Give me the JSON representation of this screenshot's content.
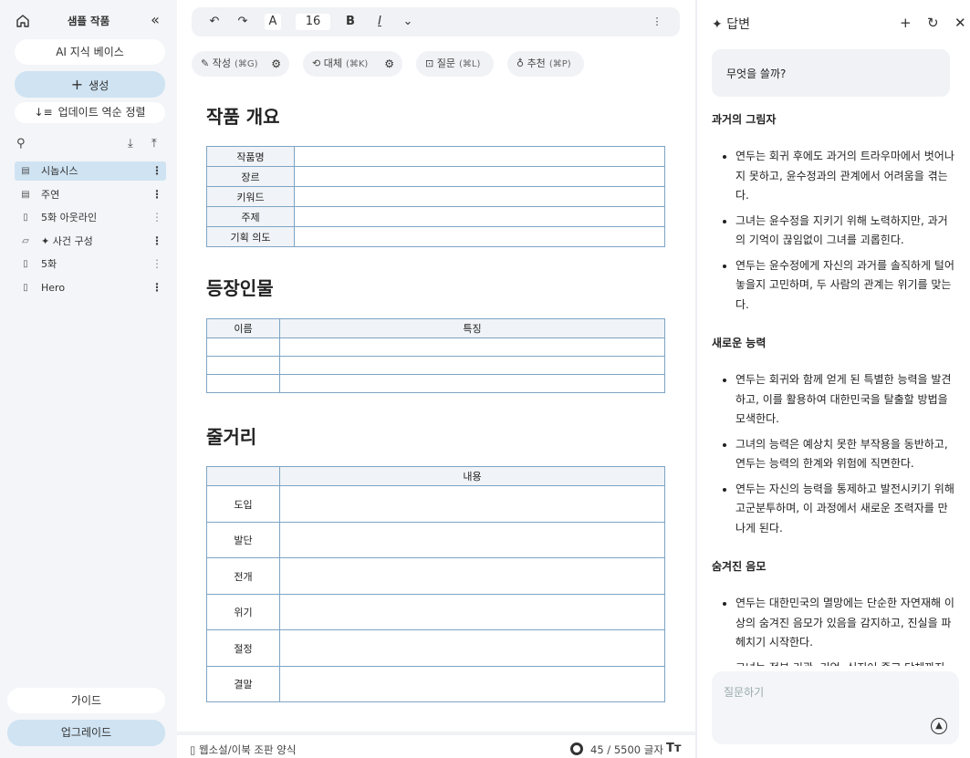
{
  "sidebar": {
    "title": "샘플 작품",
    "knowledge_base": "AI 지식 베이스",
    "create": "생성",
    "sort": "업데이트 역순 정렬",
    "items": [
      {
        "icon": "table-doc-icon",
        "label": "시놉시스",
        "active": true
      },
      {
        "icon": "table-doc-icon",
        "label": "주연",
        "active": false
      },
      {
        "icon": "document-icon",
        "label": "5화 아웃라인",
        "active": false
      },
      {
        "icon": "note-icon",
        "label": "✦ 사건 구성",
        "active": false
      },
      {
        "icon": "document-icon",
        "label": "5화",
        "active": false
      },
      {
        "icon": "document-icon",
        "label": "Hero",
        "active": false
      }
    ],
    "guide": "가이드",
    "upgrade": "업그레이드"
  },
  "toolbar": {
    "undo": "↶",
    "redo": "↷",
    "font": "A",
    "font_size": "16",
    "bold": "B",
    "italic": "I",
    "dropdown": "⌄",
    "more": "⋮"
  },
  "actions": [
    {
      "label": "작성",
      "key": "(⌘G)"
    },
    {
      "label": "대체",
      "key": "(⌘K)"
    },
    {
      "label": "질문",
      "key": "(⌘L)"
    },
    {
      "label": "추천",
      "key": "(⌘P)"
    }
  ],
  "document": {
    "overview_heading": "작품 개요",
    "overview_rows": [
      "작품명",
      "장르",
      "키워드",
      "주제",
      "기획 의도"
    ],
    "characters_heading": "등장인물",
    "characters_cols": [
      "이름",
      "특징"
    ],
    "plot_heading": "줄거리",
    "plot_col": "내용",
    "plot_rows": [
      "도입",
      "발단",
      "전개",
      "위기",
      "절정",
      "결말"
    ]
  },
  "footer": {
    "format": "웹소설/이북 조판 양식",
    "count": "45 / 5500 글자",
    "text_size": "Tт"
  },
  "panel": {
    "title": "답변",
    "prompt": "무엇을 쓸까?",
    "sections": [
      {
        "heading": "과거의 그림자",
        "bullets": [
          "연두는 회귀 후에도 과거의 트라우마에서 벗어나지 못하고, 윤수정과의 관계에서 어려움을 겪는다.",
          "그녀는 윤수정을 지키기 위해 노력하지만, 과거의 기억이 끊임없이 그녀를 괴롭힌다.",
          "연두는 윤수정에게 자신의 과거를 솔직하게 털어놓을지 고민하며, 두 사람의 관계는 위기를 맞는다."
        ]
      },
      {
        "heading": "새로운 능력",
        "bullets": [
          "연두는 회귀와 함께 얻게 된 특별한 능력을 발견하고, 이를 활용하여 대한민국을 탈출할 방법을 모색한다.",
          "그녀의 능력은 예상치 못한 부작용을 동반하고, 연두는 능력의 한계와 위험에 직면한다.",
          "연두는 자신의 능력을 통제하고 발전시키기 위해 고군분투하며, 이 과정에서 새로운 조력자를 만나게 된다."
        ]
      },
      {
        "heading": "숨겨진 음모",
        "bullets": [
          "연두는 대한민국의 멸망에는 단순한 자연재해 이상의 숨겨진 음모가 있음을 감지하고, 진실을 파헤치기 시작한다.",
          "그녀는 정부 기관, 기업, 심지어 종교 단체까지 연루된 거대한 음모의 실체를 마주하게 된다."
        ]
      }
    ],
    "ask_placeholder": "질문하기"
  }
}
